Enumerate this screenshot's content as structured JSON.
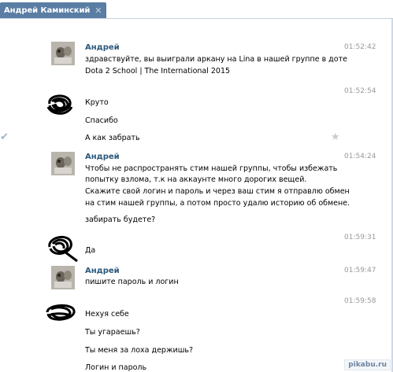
{
  "window": {
    "tab_title": "Андрей Каминский",
    "close_glyph": "✕"
  },
  "messages": [
    {
      "author": "Андрей",
      "time": "01:52:42",
      "lines": [
        "здравствуйте, вы выиграли аркану на Lina в нашей группе в доте",
        "Dota 2 School | The International 2015"
      ]
    },
    {
      "author": "",
      "time": "01:52:54",
      "lines": [
        "Круто",
        "Спасибо",
        "А как забрать"
      ]
    },
    {
      "author": "Андрей",
      "time": "01:54:24",
      "lines": [
        "Чтобы не распространять стим нашей группы, чтобы избежать",
        "попытку взлома, т.к на аккаунте много дорогих вещей.",
        "Скажите свой логин и пароль и через ваш стим я отправлю обмен",
        "на стим нашей группы, а потом просто удалю историю об обмене.",
        "забирать будете?"
      ]
    },
    {
      "author": "",
      "time": "01:59:31",
      "lines": [
        "Да"
      ]
    },
    {
      "author": "Андрей",
      "time": "01:59:47",
      "lines": [
        "пишите пароль и логин"
      ]
    },
    {
      "author": "",
      "time": "01:59:58",
      "lines": [
        "Нехуя себе",
        "Ты угараешь?",
        "Ты меня за лоха держишь?",
        "Логин и пароль"
      ]
    }
  ],
  "icons": {
    "check": "check-icon",
    "star": "star-icon"
  },
  "watermark": "pikabu.ru",
  "colors": {
    "header": "#597da3",
    "author": "#2b587a",
    "time": "#999999"
  }
}
